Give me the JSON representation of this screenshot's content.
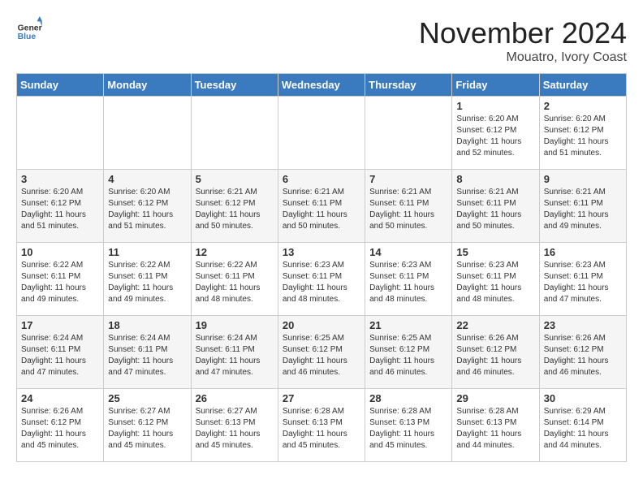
{
  "logo": {
    "general": "General",
    "blue": "Blue"
  },
  "title": "November 2024",
  "location": "Mouatro, Ivory Coast",
  "days_header": [
    "Sunday",
    "Monday",
    "Tuesday",
    "Wednesday",
    "Thursday",
    "Friday",
    "Saturday"
  ],
  "weeks": [
    [
      {
        "day": "",
        "info": ""
      },
      {
        "day": "",
        "info": ""
      },
      {
        "day": "",
        "info": ""
      },
      {
        "day": "",
        "info": ""
      },
      {
        "day": "",
        "info": ""
      },
      {
        "day": "1",
        "info": "Sunrise: 6:20 AM\nSunset: 6:12 PM\nDaylight: 11 hours and 52 minutes."
      },
      {
        "day": "2",
        "info": "Sunrise: 6:20 AM\nSunset: 6:12 PM\nDaylight: 11 hours and 51 minutes."
      }
    ],
    [
      {
        "day": "3",
        "info": "Sunrise: 6:20 AM\nSunset: 6:12 PM\nDaylight: 11 hours and 51 minutes."
      },
      {
        "day": "4",
        "info": "Sunrise: 6:20 AM\nSunset: 6:12 PM\nDaylight: 11 hours and 51 minutes."
      },
      {
        "day": "5",
        "info": "Sunrise: 6:21 AM\nSunset: 6:12 PM\nDaylight: 11 hours and 50 minutes."
      },
      {
        "day": "6",
        "info": "Sunrise: 6:21 AM\nSunset: 6:11 PM\nDaylight: 11 hours and 50 minutes."
      },
      {
        "day": "7",
        "info": "Sunrise: 6:21 AM\nSunset: 6:11 PM\nDaylight: 11 hours and 50 minutes."
      },
      {
        "day": "8",
        "info": "Sunrise: 6:21 AM\nSunset: 6:11 PM\nDaylight: 11 hours and 50 minutes."
      },
      {
        "day": "9",
        "info": "Sunrise: 6:21 AM\nSunset: 6:11 PM\nDaylight: 11 hours and 49 minutes."
      }
    ],
    [
      {
        "day": "10",
        "info": "Sunrise: 6:22 AM\nSunset: 6:11 PM\nDaylight: 11 hours and 49 minutes."
      },
      {
        "day": "11",
        "info": "Sunrise: 6:22 AM\nSunset: 6:11 PM\nDaylight: 11 hours and 49 minutes."
      },
      {
        "day": "12",
        "info": "Sunrise: 6:22 AM\nSunset: 6:11 PM\nDaylight: 11 hours and 48 minutes."
      },
      {
        "day": "13",
        "info": "Sunrise: 6:23 AM\nSunset: 6:11 PM\nDaylight: 11 hours and 48 minutes."
      },
      {
        "day": "14",
        "info": "Sunrise: 6:23 AM\nSunset: 6:11 PM\nDaylight: 11 hours and 48 minutes."
      },
      {
        "day": "15",
        "info": "Sunrise: 6:23 AM\nSunset: 6:11 PM\nDaylight: 11 hours and 48 minutes."
      },
      {
        "day": "16",
        "info": "Sunrise: 6:23 AM\nSunset: 6:11 PM\nDaylight: 11 hours and 47 minutes."
      }
    ],
    [
      {
        "day": "17",
        "info": "Sunrise: 6:24 AM\nSunset: 6:11 PM\nDaylight: 11 hours and 47 minutes."
      },
      {
        "day": "18",
        "info": "Sunrise: 6:24 AM\nSunset: 6:11 PM\nDaylight: 11 hours and 47 minutes."
      },
      {
        "day": "19",
        "info": "Sunrise: 6:24 AM\nSunset: 6:11 PM\nDaylight: 11 hours and 47 minutes."
      },
      {
        "day": "20",
        "info": "Sunrise: 6:25 AM\nSunset: 6:12 PM\nDaylight: 11 hours and 46 minutes."
      },
      {
        "day": "21",
        "info": "Sunrise: 6:25 AM\nSunset: 6:12 PM\nDaylight: 11 hours and 46 minutes."
      },
      {
        "day": "22",
        "info": "Sunrise: 6:26 AM\nSunset: 6:12 PM\nDaylight: 11 hours and 46 minutes."
      },
      {
        "day": "23",
        "info": "Sunrise: 6:26 AM\nSunset: 6:12 PM\nDaylight: 11 hours and 46 minutes."
      }
    ],
    [
      {
        "day": "24",
        "info": "Sunrise: 6:26 AM\nSunset: 6:12 PM\nDaylight: 11 hours and 45 minutes."
      },
      {
        "day": "25",
        "info": "Sunrise: 6:27 AM\nSunset: 6:12 PM\nDaylight: 11 hours and 45 minutes."
      },
      {
        "day": "26",
        "info": "Sunrise: 6:27 AM\nSunset: 6:13 PM\nDaylight: 11 hours and 45 minutes."
      },
      {
        "day": "27",
        "info": "Sunrise: 6:28 AM\nSunset: 6:13 PM\nDaylight: 11 hours and 45 minutes."
      },
      {
        "day": "28",
        "info": "Sunrise: 6:28 AM\nSunset: 6:13 PM\nDaylight: 11 hours and 45 minutes."
      },
      {
        "day": "29",
        "info": "Sunrise: 6:28 AM\nSunset: 6:13 PM\nDaylight: 11 hours and 44 minutes."
      },
      {
        "day": "30",
        "info": "Sunrise: 6:29 AM\nSunset: 6:14 PM\nDaylight: 11 hours and 44 minutes."
      }
    ]
  ]
}
